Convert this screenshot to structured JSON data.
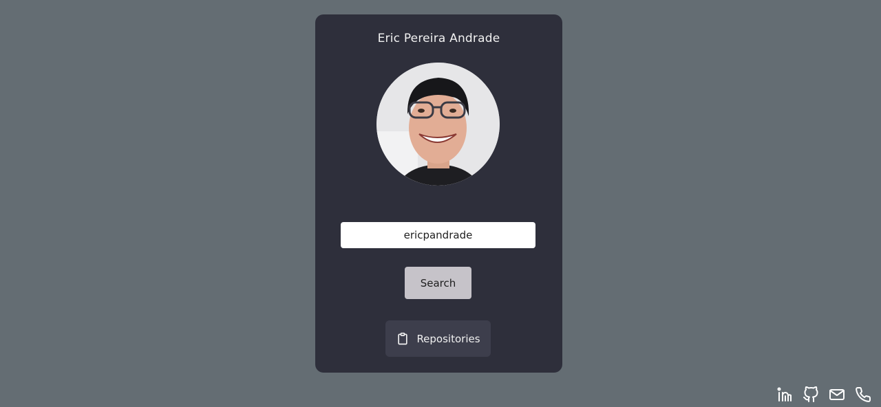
{
  "profile": {
    "name": "Eric Pereira Andrade",
    "avatar_icon": "user-photo"
  },
  "search": {
    "value": "ericpandrade",
    "placeholder": "",
    "button_label": "Search"
  },
  "repositories": {
    "label": "Repositories",
    "icon": "clipboard-icon"
  },
  "social": {
    "items": [
      {
        "name": "linkedin-icon"
      },
      {
        "name": "github-icon"
      },
      {
        "name": "mail-icon"
      },
      {
        "name": "phone-icon"
      }
    ]
  },
  "colors": {
    "background": "#646d73",
    "card": "#2e2f3b",
    "search_button": "#c6c3c9",
    "repo_button": "#3d3e4c"
  }
}
